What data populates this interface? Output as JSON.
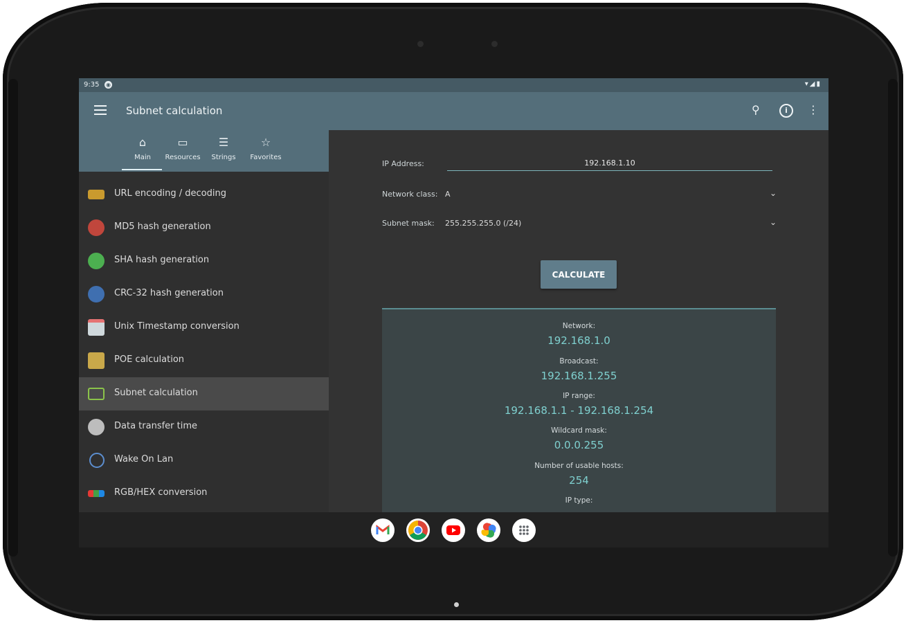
{
  "status_bar": {
    "time": "9:35",
    "badge": "◉",
    "icons": "▾◢▮"
  },
  "app_bar": {
    "title": "Subnet calculation"
  },
  "tabs": [
    {
      "label": "Main",
      "icon": "⌂"
    },
    {
      "label": "Resources",
      "icon": "▭"
    },
    {
      "label": "Strings",
      "icon": "☰"
    },
    {
      "label": "Favorites",
      "icon": "☆"
    }
  ],
  "menu_items": [
    {
      "label": "URL encoding / decoding",
      "icon": "url-icon",
      "color": "#c99a2e"
    },
    {
      "label": "MD5 hash generation",
      "icon": "md5-icon",
      "color": "#c0463c"
    },
    {
      "label": "SHA hash generation",
      "icon": "sha-icon",
      "color": "#4caf50"
    },
    {
      "label": "CRC-32 hash generation",
      "icon": "crc-icon",
      "color": "#3f6fb0"
    },
    {
      "label": "Unix Timestamp conversion",
      "icon": "calendar-icon",
      "color": "#cfd8dc"
    },
    {
      "label": "POE calculation",
      "icon": "poe-icon",
      "color": "#c9a84a"
    },
    {
      "label": "Subnet calculation",
      "icon": "subnet-icon",
      "color": "#8bc34a"
    },
    {
      "label": "Data transfer time",
      "icon": "transfer-icon",
      "color": "#bdbdbd"
    },
    {
      "label": "Wake On Lan",
      "icon": "power-icon",
      "color": "#5c8ecf"
    },
    {
      "label": "RGB/HEX conversion",
      "icon": "rgb-icon",
      "color": "#e0e0e0"
    }
  ],
  "form": {
    "ip_label": "IP Address:",
    "ip_value": "192.168.1.10",
    "class_label": "Network class:",
    "class_value": "A",
    "mask_label": "Subnet mask:",
    "mask_value": "255.255.255.0  (/24)",
    "calculate_label": "CALCULATE"
  },
  "results": {
    "network_label": "Network:",
    "network_value": "192.168.1.0",
    "broadcast_label": "Broadcast:",
    "broadcast_value": "192.168.1.255",
    "range_label": "IP range:",
    "range_value": "192.168.1.1 - 192.168.1.254",
    "wildcard_label": "Wildcard mask:",
    "wildcard_value": "0.0.0.255",
    "hosts_label": "Number of usable hosts:",
    "hosts_value": "254",
    "iptype_label": "IP type:"
  },
  "dock": [
    "Gmail",
    "Chrome",
    "YouTube",
    "Photos",
    "App list"
  ]
}
